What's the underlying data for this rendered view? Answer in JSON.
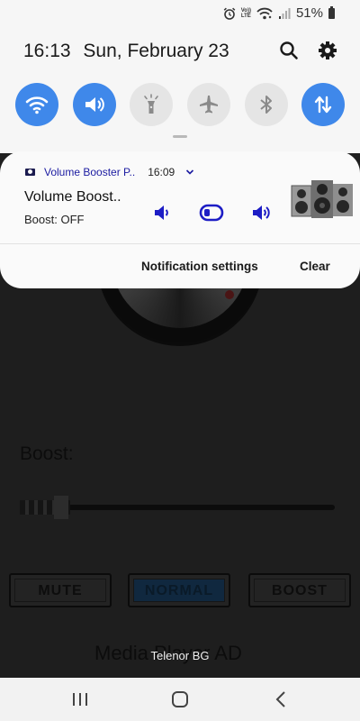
{
  "status_bar": {
    "battery_text": "51%",
    "volte_line1": "Vo))",
    "volte_line2": "LTE"
  },
  "header": {
    "time": "16:13",
    "date": "Sun, February 23"
  },
  "quick_tiles": [
    {
      "name": "wifi",
      "state": "on"
    },
    {
      "name": "sound",
      "state": "on"
    },
    {
      "name": "flashlight",
      "state": "off"
    },
    {
      "name": "airplane-mode",
      "state": "off"
    },
    {
      "name": "bluetooth",
      "state": "off"
    },
    {
      "name": "mobile-data",
      "state": "on"
    }
  ],
  "notification": {
    "app_name": "Volume Booster P..",
    "time": "16:09",
    "title": "Volume Boost..",
    "subtitle": "Boost: OFF",
    "actions": {
      "settings": "Notification settings",
      "clear": "Clear"
    }
  },
  "background_app": {
    "boost_label": "Boost:",
    "buttons": [
      "MUTE",
      "NORMAL",
      "BOOST"
    ],
    "selected_button": "NORMAL",
    "footer_text": "Media Player AD",
    "boost_level_fraction": 0.15
  },
  "carrier": "Telenor BG",
  "colors": {
    "accent": "#3f88ea",
    "notif_icon": "#1d1dc5",
    "app_name": "#1b1ba1"
  }
}
